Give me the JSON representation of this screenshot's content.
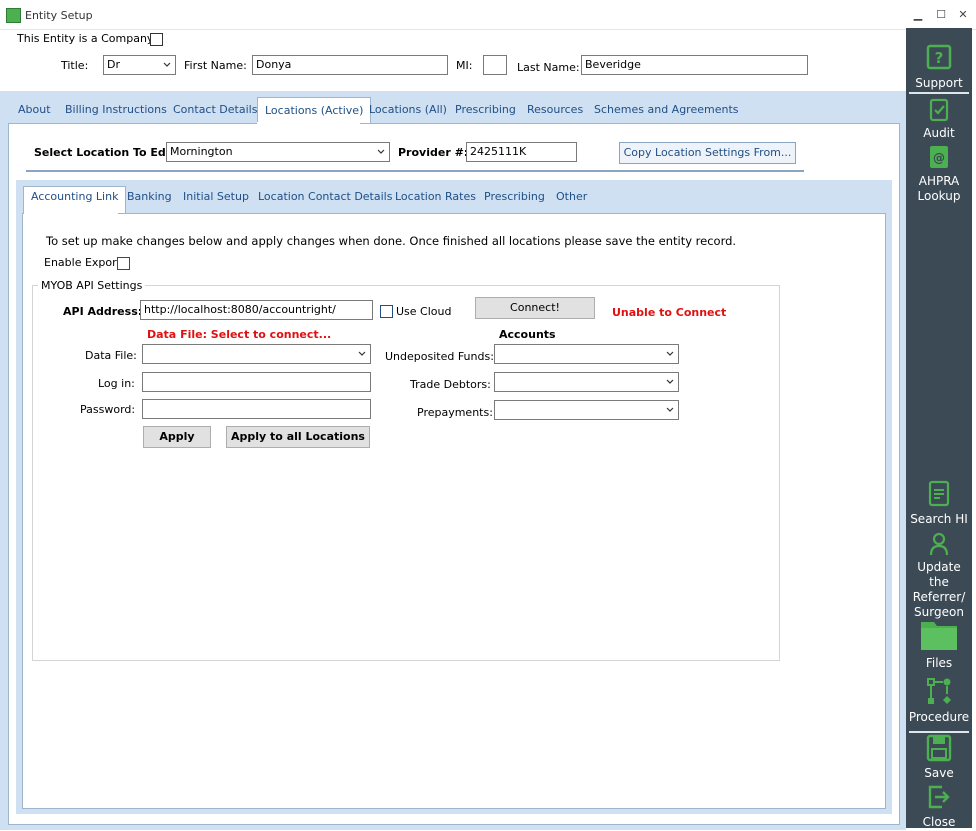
{
  "window": {
    "title": "Entity Setup",
    "minimize": "▁",
    "maximize": "☐",
    "close": "✕"
  },
  "header": {
    "company_label": "This Entity is a Company",
    "title_label": "Title:",
    "title_value": "Dr",
    "first_name_label": "First Name:",
    "first_name_value": "Donya",
    "mi_label": "MI:",
    "mi_value": "",
    "last_name_label": "Last Name:",
    "last_name_value": "Beveridge"
  },
  "main_tabs": [
    {
      "label": "About"
    },
    {
      "label": "Billing Instructions"
    },
    {
      "label": "Contact Details"
    },
    {
      "label": "Locations (Active)",
      "active": true
    },
    {
      "label": "Locations (All)"
    },
    {
      "label": "Prescribing"
    },
    {
      "label": "Resources"
    },
    {
      "label": "Schemes and Agreements"
    }
  ],
  "location": {
    "select_label": "Select Location To Edit:",
    "select_value": "Mornington",
    "provider_label": "Provider #:",
    "provider_value": "2425111K",
    "copy_button": "Copy Location Settings From..."
  },
  "sub_tabs": [
    {
      "label": "Accounting Link",
      "active": true
    },
    {
      "label": "Banking"
    },
    {
      "label": "Initial Setup"
    },
    {
      "label": "Location Contact Details"
    },
    {
      "label": "Location Rates"
    },
    {
      "label": "Prescribing"
    },
    {
      "label": "Other"
    }
  ],
  "accounting": {
    "instructions": "To set up make changes below and apply changes when done. Once finished all locations please save the entity record.",
    "enable_export_label": "Enable Export",
    "group_title": "MYOB API Settings",
    "api_address_label": "API Address:",
    "api_address_value": "http://localhost:8080/accountright/",
    "use_cloud_label": "Use Cloud",
    "connect_button": "Connect!",
    "connect_status": "Unable to Connect",
    "data_file_status": "Data File: Select to connect...",
    "data_file_label": "Data File:",
    "data_file_value": "",
    "login_label": "Log in:",
    "login_value": "",
    "password_label": "Password:",
    "password_value": "",
    "apply_button": "Apply",
    "apply_all_button": "Apply to all Locations",
    "accounts_heading": "Accounts",
    "undeposited_label": "Undeposited Funds:",
    "undeposited_value": "",
    "trade_debtors_label": "Trade Debtors:",
    "trade_debtors_value": "",
    "prepayments_label": "Prepayments:",
    "prepayments_value": ""
  },
  "sidebar": {
    "support": "Support",
    "audit": "Audit",
    "ahpra": "AHPRA Lookup",
    "search_hi": "Search HI",
    "update_referrer": "Update the Referrer/ Surgeon",
    "files": "Files",
    "procedure": "Procedure",
    "save": "Save",
    "close": "Close"
  },
  "colors": {
    "accent_green": "#4caf50",
    "sidebar": "#3b4a55",
    "tab_blue": "#1f4f86",
    "error_red": "#e01010"
  }
}
